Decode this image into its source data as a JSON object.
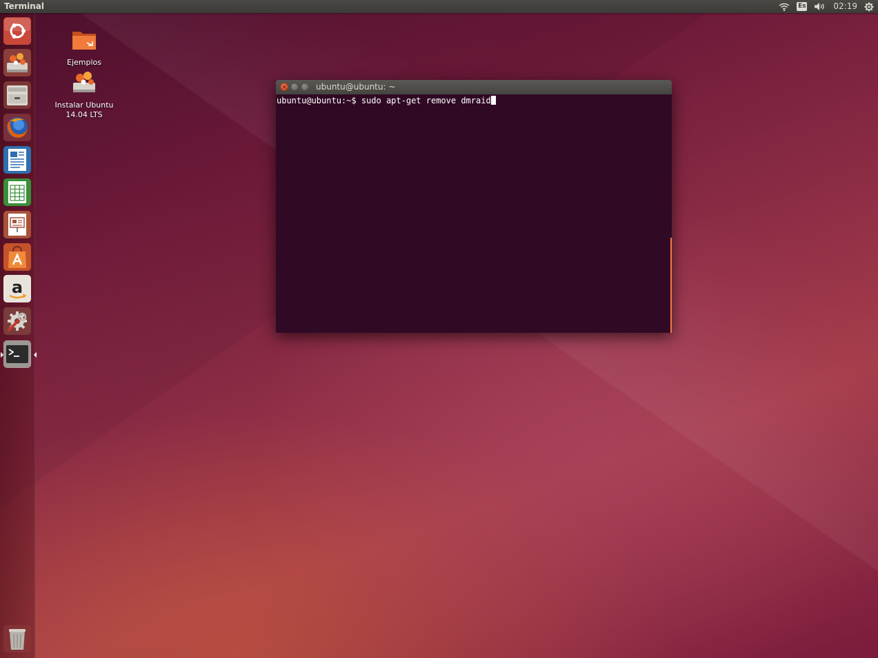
{
  "top_panel": {
    "app_title": "Terminal",
    "keyboard_layout": "Es",
    "clock": "02:19",
    "icons": [
      "wifi-icon",
      "keyboard-layout-indicator",
      "volume-icon",
      "session-gear-icon"
    ]
  },
  "launcher": {
    "items": [
      {
        "name": "dash-home",
        "icon": "ubuntu-logo-icon"
      },
      {
        "name": "install-ubuntu",
        "icon": "installer-icon"
      },
      {
        "name": "files",
        "icon": "file-cabinet-icon"
      },
      {
        "name": "firefox",
        "icon": "firefox-icon"
      },
      {
        "name": "libreoffice-writer",
        "icon": "writer-document-icon"
      },
      {
        "name": "libreoffice-calc",
        "icon": "calc-spreadsheet-icon"
      },
      {
        "name": "libreoffice-impress",
        "icon": "impress-presentation-icon"
      },
      {
        "name": "ubuntu-software-center",
        "icon": "software-center-bag-icon"
      },
      {
        "name": "amazon",
        "icon": "amazon-icon"
      },
      {
        "name": "system-settings",
        "icon": "settings-wrench-gear-icon"
      },
      {
        "name": "terminal",
        "icon": "terminal-icon",
        "active": true
      },
      {
        "name": "trash",
        "icon": "trash-icon"
      }
    ]
  },
  "desktop_icons": [
    {
      "label": "Ejemplos",
      "icon": "folder-icon"
    },
    {
      "label_line1": "Instalar Ubuntu",
      "label_line2": "14.04 LTS",
      "icon": "installer-icon"
    }
  ],
  "terminal": {
    "title": "ubuntu@ubuntu: ~",
    "prompt": "ubuntu@ubuntu:~$ ",
    "command": "sudo apt-get remove dmraid"
  },
  "colors": {
    "panel": "#3c3b37",
    "terminal_bg": "#300a24",
    "accent_orange": "#f47a4c",
    "close_button": "#df4a16"
  }
}
